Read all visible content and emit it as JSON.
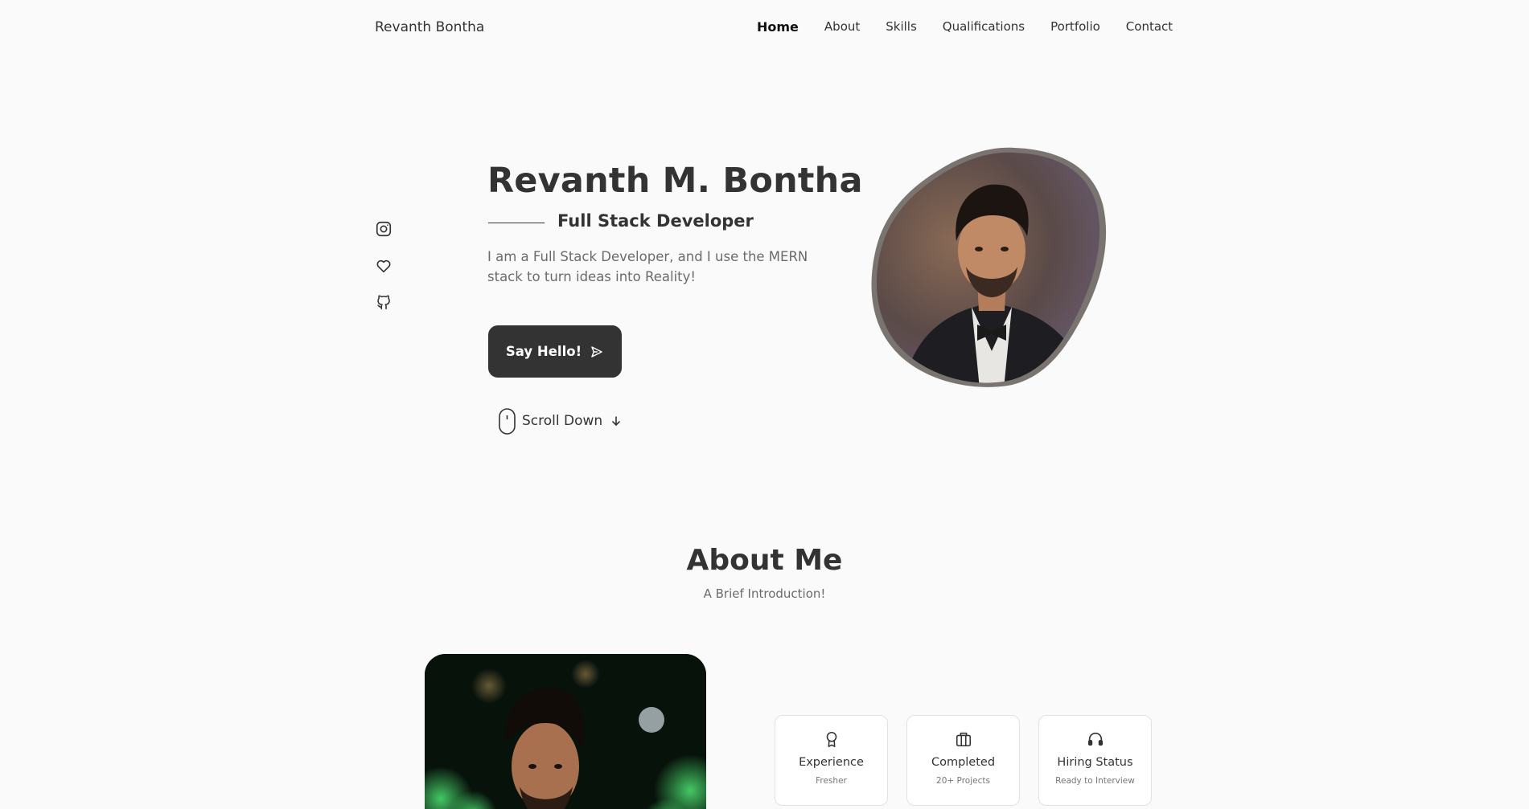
{
  "header": {
    "logo": "Revanth Bontha",
    "nav": [
      "Home",
      "About",
      "Skills",
      "Qualifications",
      "Portfolio",
      "Contact"
    ],
    "active": "Home"
  },
  "social": {
    "icons": [
      "instagram-icon",
      "heart-icon",
      "github-icon"
    ]
  },
  "hero": {
    "title": "Revanth M. Bontha",
    "subtitle": "Full Stack Developer",
    "description": "I am a Full Stack Developer, and I use the MERN stack to turn ideas into Reality!",
    "button_label": "Say Hello!",
    "scroll_label": "Scroll Down"
  },
  "about": {
    "title": "About Me",
    "subtitle": "A Brief Introduction!",
    "cards": [
      {
        "title": "Experience",
        "sub": "Fresher",
        "icon": "award-icon"
      },
      {
        "title": "Completed",
        "sub": "20+ Projects",
        "icon": "briefcase-icon"
      },
      {
        "title": "Hiring Status",
        "sub": "Ready to Interview",
        "icon": "headphones-icon"
      }
    ]
  },
  "colors": {
    "background": "#fafafa",
    "text": "#333333",
    "button": "#333333",
    "muted": "#6b6b6b"
  }
}
